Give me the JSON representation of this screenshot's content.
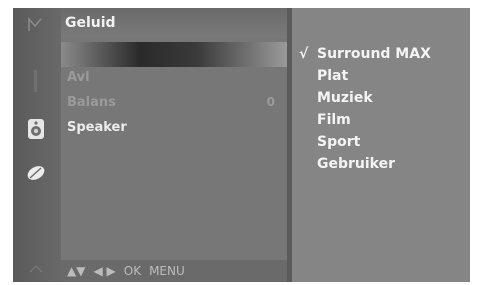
{
  "menu": {
    "title": "Geluid",
    "items": [
      {
        "label": "Avl",
        "value": ""
      },
      {
        "label": "Balans",
        "value": "0"
      },
      {
        "label": "Speaker",
        "value": ""
      }
    ],
    "footer": {
      "updown": "▲▼",
      "leftright": "◀ ▶",
      "ok": "OK",
      "menu": "MENU"
    }
  },
  "submenu": {
    "check_mark": "√",
    "items": [
      "Surround MAX",
      "Plat",
      "Muziek",
      "Film",
      "Sport",
      "Gebruiker"
    ]
  },
  "rail": {
    "icons": [
      "picture-icon",
      "volume-icon",
      "speaker-icon",
      "leaf-icon",
      "settings-icon"
    ]
  }
}
